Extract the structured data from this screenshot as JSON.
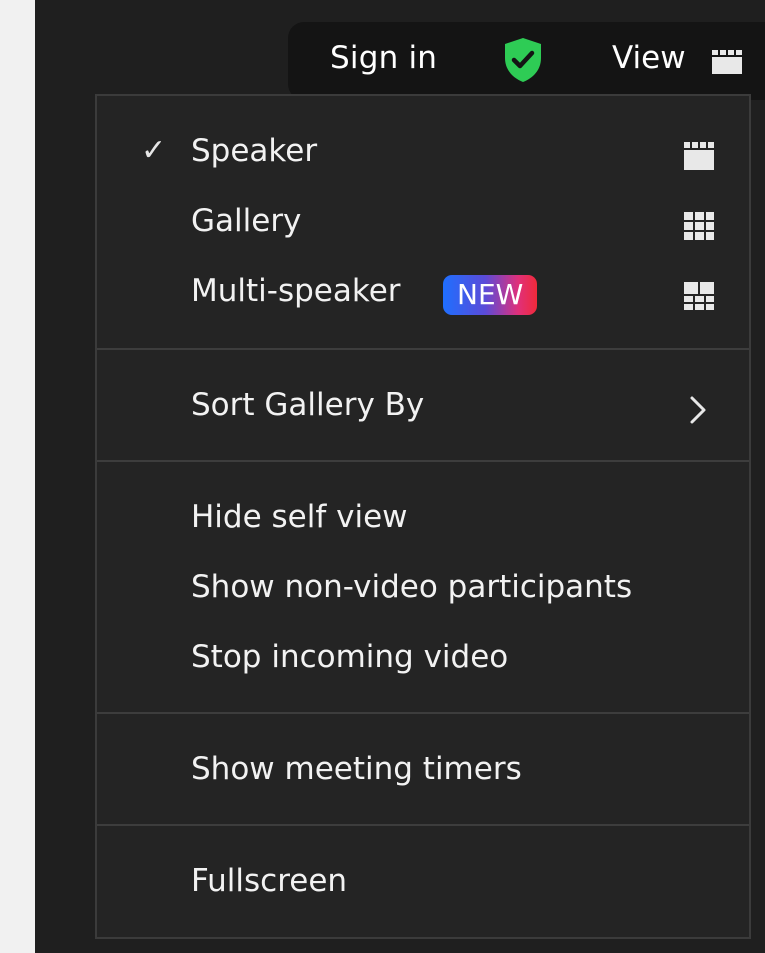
{
  "topbar": {
    "signin_label": "Sign in",
    "security_icon": "shield-check-icon",
    "security_color": "#2ecc55",
    "view_label": "View",
    "view_icon": "speaker-layout-icon"
  },
  "menu": {
    "layout_items": [
      {
        "label": "Speaker",
        "checked": true,
        "icon": "speaker-layout-icon"
      },
      {
        "label": "Gallery",
        "checked": false,
        "icon": "gallery-grid-icon"
      },
      {
        "label": "Multi-speaker",
        "checked": false,
        "badge": "NEW",
        "icon": "multi-speaker-grid-icon"
      }
    ],
    "check_glyph": "✓",
    "sort_label": "Sort Gallery By",
    "video_items": [
      {
        "label": "Hide self view"
      },
      {
        "label": "Show non-video participants"
      },
      {
        "label": "Stop incoming video"
      }
    ],
    "timers_label": "Show meeting timers",
    "fullscreen_label": "Fullscreen"
  },
  "colors": {
    "app_bg": "#1f1f1f",
    "menu_bg": "#242424",
    "text": "#f2f2f2",
    "badge_gradient": [
      "#1f6fff",
      "#e0307a",
      "#f02a3a"
    ]
  }
}
